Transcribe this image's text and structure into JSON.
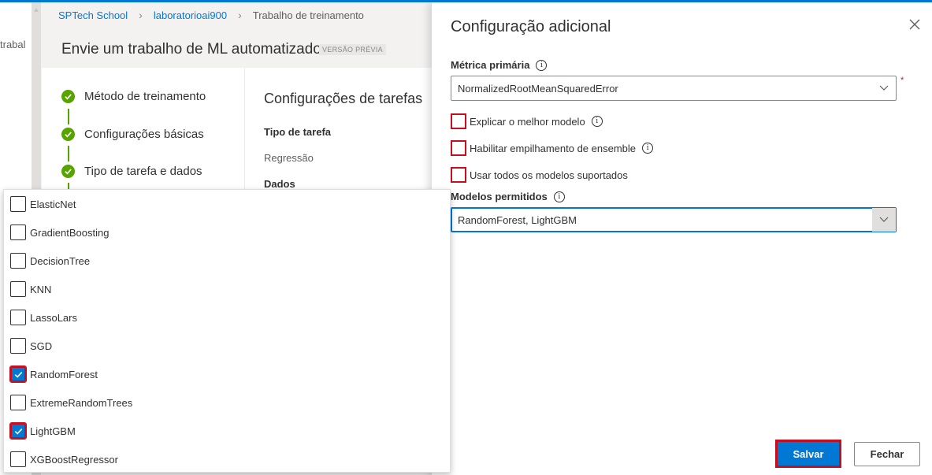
{
  "background": {
    "left_nav_text": "trabal",
    "breadcrumb": [
      "SPTech School",
      "laboratorioai900",
      "Trabalho de treinamento"
    ],
    "wizard_title": "Envie um trabalho de ML automatizado",
    "preview_badge": "VERSÃO PRÉVIA",
    "steps": [
      {
        "label": "Método de treinamento",
        "icon": "check-circle-icon"
      },
      {
        "label": "Configurações básicas",
        "icon": "check-circle-icon"
      },
      {
        "label": "Tipo de tarefa e dados",
        "icon": "check-circle-icon"
      }
    ],
    "task_settings": {
      "heading": "Configurações de tarefas",
      "task_type_label": "Tipo de tarefa",
      "task_type_value": "Regressão",
      "data_label": "Dados"
    }
  },
  "models_dropdown": {
    "options": [
      {
        "label": "ElasticNet",
        "checked": false
      },
      {
        "label": "GradientBoosting",
        "checked": false
      },
      {
        "label": "DecisionTree",
        "checked": false
      },
      {
        "label": "KNN",
        "checked": false
      },
      {
        "label": "LassoLars",
        "checked": false
      },
      {
        "label": "SGD",
        "checked": false
      },
      {
        "label": "RandomForest",
        "checked": true
      },
      {
        "label": "ExtremeRandomTrees",
        "checked": false
      },
      {
        "label": "LightGBM",
        "checked": true
      },
      {
        "label": "XGBoostRegressor",
        "checked": false
      }
    ]
  },
  "panel": {
    "title": "Configuração adicional",
    "primary_metric": {
      "label": "Métrica primária",
      "value": "NormalizedRootMeanSquaredError",
      "required_mark": "*"
    },
    "checkboxes": [
      {
        "label": "Explicar o melhor modelo",
        "checked": false,
        "has_info": true
      },
      {
        "label": "Habilitar empilhamento de ensemble",
        "checked": false,
        "has_info": true
      },
      {
        "label": "Usar todos os modelos suportados",
        "checked": false,
        "has_info": false
      }
    ],
    "allowed_models": {
      "label": "Modelos permitidos",
      "value": "RandomForest, LightGBM"
    },
    "save_button": "Salvar",
    "close_button": "Fechar",
    "info_glyph": "i"
  },
  "colors": {
    "accent": "#0078d4",
    "success": "#57a300",
    "highlight": "#c50f1f"
  }
}
